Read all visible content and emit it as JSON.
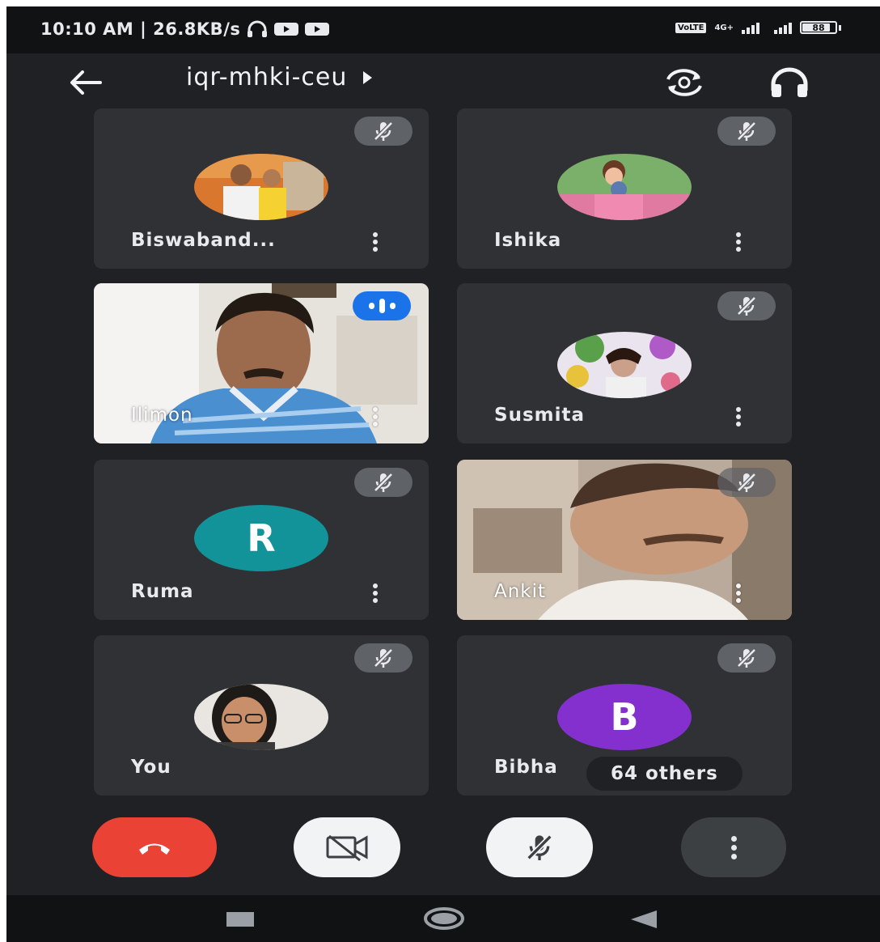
{
  "status_bar": {
    "time_speed": "10:10 AM | 26.8KB/s",
    "network_badge": "VoLTE",
    "network_type": "4G+",
    "battery": "88"
  },
  "header": {
    "meeting_code": "iqr-mhki-ceu",
    "icons": [
      "back-arrow-icon",
      "switch-camera-icon",
      "headphones-icon"
    ]
  },
  "participants": [
    {
      "name": "Biswaband...",
      "muted": true
    },
    {
      "name": "Ishika",
      "muted": true
    },
    {
      "name": "Ilimon",
      "speaking": true
    },
    {
      "name": "Susmita",
      "muted": true
    },
    {
      "name": "Ruma",
      "initial": "R",
      "avatar_color": "#12939a",
      "muted": true
    },
    {
      "name": "Ankit",
      "muted": true
    },
    {
      "name": "You",
      "muted": true
    },
    {
      "name": "Bibha",
      "initial": "B",
      "avatar_color": "#8430ce",
      "muted": true
    }
  ],
  "others_chip": "64 others",
  "controls": {
    "end_call_color": "#ea4335",
    "icons": [
      "end-call-icon",
      "camera-off-icon",
      "mic-off-icon",
      "more-vert-icon"
    ]
  }
}
